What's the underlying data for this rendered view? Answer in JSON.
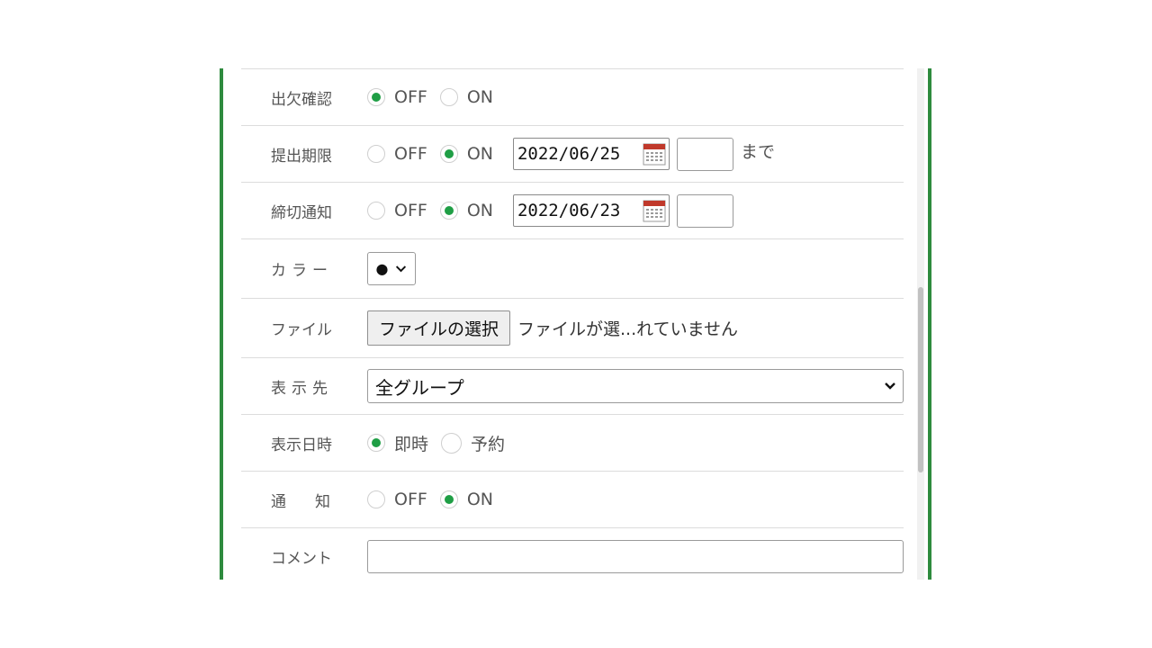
{
  "form": {
    "attendance": {
      "label": "出欠確認",
      "options": [
        "OFF",
        "ON"
      ],
      "selected": "OFF"
    },
    "deadline": {
      "label": "提出期限",
      "options": [
        "OFF",
        "ON"
      ],
      "selected": "ON",
      "date": "2022/06/25",
      "suffix": "まで"
    },
    "deadline_notice": {
      "label": "締切通知",
      "options": [
        "OFF",
        "ON"
      ],
      "selected": "ON",
      "date": "2022/06/23"
    },
    "color": {
      "label": "カラー",
      "value": "●"
    },
    "file": {
      "label": "ファイル",
      "button": "ファイルの選択",
      "status": "ファイルが選...れていません"
    },
    "target": {
      "label": "表示先",
      "value": "全グループ"
    },
    "display_time": {
      "label": "表示日時",
      "options": [
        "即時",
        "予約"
      ],
      "selected": "即時"
    },
    "notify": {
      "label": "通知",
      "options": [
        "OFF",
        "ON"
      ],
      "selected": "ON"
    },
    "comment": {
      "label": "コメント",
      "value": ""
    }
  },
  "colors": {
    "accent_border": "#2e8b3e",
    "radio_checked": "#1f9e45",
    "calendar_red": "#c0392b"
  },
  "icons": {
    "calendar": "calendar-icon",
    "chevron": "chevron-down-icon"
  }
}
